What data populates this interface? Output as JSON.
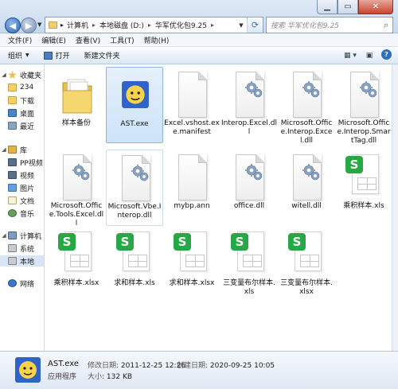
{
  "address": {
    "crumbs": [
      "计算机",
      "本地磁盘 (D:)",
      "华军优化包9.25"
    ]
  },
  "search": {
    "placeholder": "搜索 华军优化包9.25"
  },
  "menu": [
    "文件(F)",
    "编辑(E)",
    "查看(V)",
    "工具(T)",
    "帮助(H)"
  ],
  "toolbar": {
    "organize": "组织",
    "open": "打开",
    "new_folder": "新建文件夹"
  },
  "nav": {
    "favorites": "收藏夹",
    "fav_items": [
      "234",
      "下载",
      "桌面",
      "最近"
    ],
    "libraries": "库",
    "lib_items": [
      "PP视频",
      "视频",
      "图片",
      "文档",
      "音乐"
    ],
    "computer": "计算机",
    "comp_items": [
      "系统",
      "本地"
    ],
    "network": "网络"
  },
  "files": [
    {
      "name": "样本备份",
      "kind": "folder"
    },
    {
      "name": "AST.exe",
      "kind": "exe",
      "state": "selected"
    },
    {
      "name": "Excel.vshost.exe.manifest",
      "kind": "blank"
    },
    {
      "name": "Interop.Excel.dll",
      "kind": "dll"
    },
    {
      "name": "Microsoft.Office.Interop.Excel.dll",
      "kind": "dll"
    },
    {
      "name": "Microsoft.Office.Interop.SmartTag.dll",
      "kind": "dll"
    },
    {
      "name": "Microsoft.Office.Tools.Excel.dll",
      "kind": "dll"
    },
    {
      "name": "Microsoft.Vbe.Interop.dll",
      "kind": "dll",
      "state": "hover"
    },
    {
      "name": "mybp.ann",
      "kind": "blank"
    },
    {
      "name": "office.dll",
      "kind": "dll"
    },
    {
      "name": "witell.dll",
      "kind": "dll"
    },
    {
      "name": "乘积样本.xls",
      "kind": "sheet"
    },
    {
      "name": "乘积样本.xlsx",
      "kind": "sheet"
    },
    {
      "name": "求和样本.xls",
      "kind": "sheet"
    },
    {
      "name": "求和样本.xlsx",
      "kind": "sheet"
    },
    {
      "name": "三变量布尔样本.xls",
      "kind": "sheet"
    },
    {
      "name": "三变量布尔样本.xlsx",
      "kind": "sheet"
    }
  ],
  "details": {
    "name": "AST.exe",
    "type": "应用程序",
    "modified_label": "修改日期:",
    "modified": "2011-12-25 12:26",
    "created_label": "创建日期:",
    "created": "2020-09-25 10:05",
    "size_label": "大小:",
    "size": "132 KB"
  },
  "colors": {
    "sheet_badge": "#27a844",
    "selection": "#cde3f9",
    "folder": "#f2cf6b"
  }
}
